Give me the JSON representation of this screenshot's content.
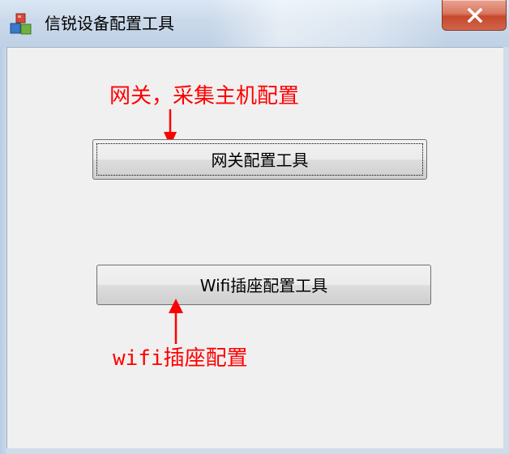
{
  "window": {
    "title": "信锐设备配置工具",
    "close_symbol": "X",
    "app_icon": "app-blocks-icon"
  },
  "annotations": {
    "gateway_note": "网关，采集主机配置",
    "wifi_note": "wifi插座配置",
    "color": "#ff0000"
  },
  "buttons": {
    "gateway_label": "网关配置工具",
    "wifi_label": "Wifi插座配置工具"
  }
}
